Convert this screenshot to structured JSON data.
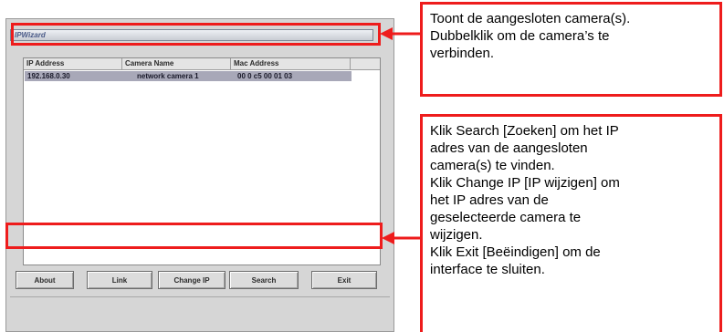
{
  "window": {
    "title": "IPWizard",
    "columns": [
      "IP Address",
      "Camera Name",
      "Mac Address"
    ],
    "rows": [
      {
        "ip": "192.168.0.30",
        "name": "network camera 1",
        "mac": "00 0 c5 00 01 03"
      }
    ],
    "buttons": {
      "about": "About",
      "link": "Link",
      "change_ip": "Change IP",
      "search": "Search",
      "exit": "Exit"
    }
  },
  "callouts": {
    "top": [
      "Toont de aangesloten camera(s).",
      "Dubbelklik om de camera’s te",
      "verbinden."
    ],
    "bottom": [
      "Klik Search [Zoeken] om het IP",
      "adres van de aangesloten",
      "camera(s) te vinden.",
      "Klik Change IP [IP wijzigen] om",
      "het IP adres van de",
      "geselecteerde camera te",
      "wijzigen.",
      "Klik Exit [Beëindigen] om de",
      "interface te sluiten."
    ]
  },
  "colors": {
    "callout_border": "#ee1c1c",
    "window_bg": "#d6d6d6",
    "selected_row": "#a8a8b8"
  }
}
